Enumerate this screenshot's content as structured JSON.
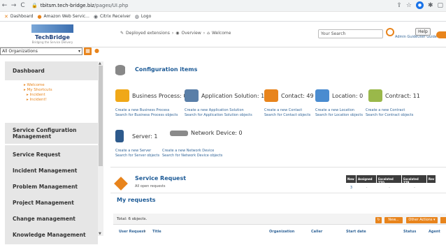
{
  "browser": {
    "back": "←",
    "forward": "→",
    "reload": "C",
    "url_host": "tbitsm.tech-bridge.biz",
    "url_path": "/pages/UI.php",
    "bookmarks": [
      {
        "label": "Dashboard",
        "icon": "dashboard-icon"
      },
      {
        "label": "Amazon Web Servic...",
        "icon": "aws-icon"
      },
      {
        "label": "Citrix Receiver",
        "icon": "citrix-icon"
      },
      {
        "label": "Logo",
        "icon": "globe-icon"
      }
    ]
  },
  "header": {
    "logo_text": "TechBridge",
    "logo_tagline": "Bridging the Service Delivery",
    "org_select": "All Organizations",
    "breadcrumb": [
      "Deployed extensions",
      "Overview",
      "Welcome"
    ],
    "search_placeholder": "Your Search",
    "admin_link": "Admin Guide",
    "user_guide": "User Guide",
    "help_label": "Help"
  },
  "sidebar": {
    "sections": [
      {
        "label": "Dashboard",
        "subitems": [
          "Welcome",
          "My Shortcuts",
          "Incident",
          "Incident!"
        ]
      },
      {
        "label": "Service Configuration Management"
      },
      {
        "label": "Service Request"
      },
      {
        "label": "Incident Management"
      },
      {
        "label": "Problem Management"
      },
      {
        "label": "Project Management"
      },
      {
        "label": "Change management"
      },
      {
        "label": "Knowledge Management"
      }
    ]
  },
  "config": {
    "title": "Configuration items",
    "items": [
      {
        "label": "Business Process: 0",
        "icon": "business-process-icon",
        "color": "#f0a818"
      },
      {
        "label": "Application Solution: 11",
        "icon": "application-solution-icon",
        "color": "#5a7fa8"
      },
      {
        "label": "Contact: 49",
        "icon": "contact-icon",
        "color": "#e8841c"
      },
      {
        "label": "Location: 0",
        "icon": "location-icon",
        "color": "#4a8cd0"
      },
      {
        "label": "Contract: 11",
        "icon": "contract-icon",
        "color": "#9ab84a"
      },
      {
        "label": "Server: 1",
        "icon": "server-icon",
        "color": "#2d5a8c"
      },
      {
        "label": "Network Device: 0",
        "icon": "network-device-icon",
        "color": "#8a8a8a"
      }
    ],
    "links": [
      [
        "Create a new Business Process",
        "Search for Business Process objects"
      ],
      [
        "Create a new Application Solution",
        "Search for Application Solution objects"
      ],
      [
        "Create a new Contact",
        "Search for Contact objects"
      ],
      [
        "Create a new Location",
        "Search for Location objects"
      ],
      [
        "Create a new Contract",
        "Search for Contract objects"
      ],
      [
        "Create a new Server",
        "Search for Server objects"
      ],
      [
        "Create a new Network Device",
        "Search for Network Device objects"
      ]
    ]
  },
  "service_request": {
    "title": "Service Request",
    "subtitle": "All open requests",
    "columns": [
      "New",
      "Assigned",
      "Escalated TTO",
      "Escalated TTR",
      "Rev"
    ],
    "values": [
      "3",
      "-",
      "-",
      "-",
      ""
    ]
  },
  "my_requests": {
    "title": "My requests",
    "total": "Total: 6 objects.",
    "new_button": "New...",
    "other_actions": "Other Actions",
    "columns": [
      "User Request",
      "Title",
      "Organization",
      "Caller",
      "Start date",
      "Status",
      "Agent"
    ]
  }
}
